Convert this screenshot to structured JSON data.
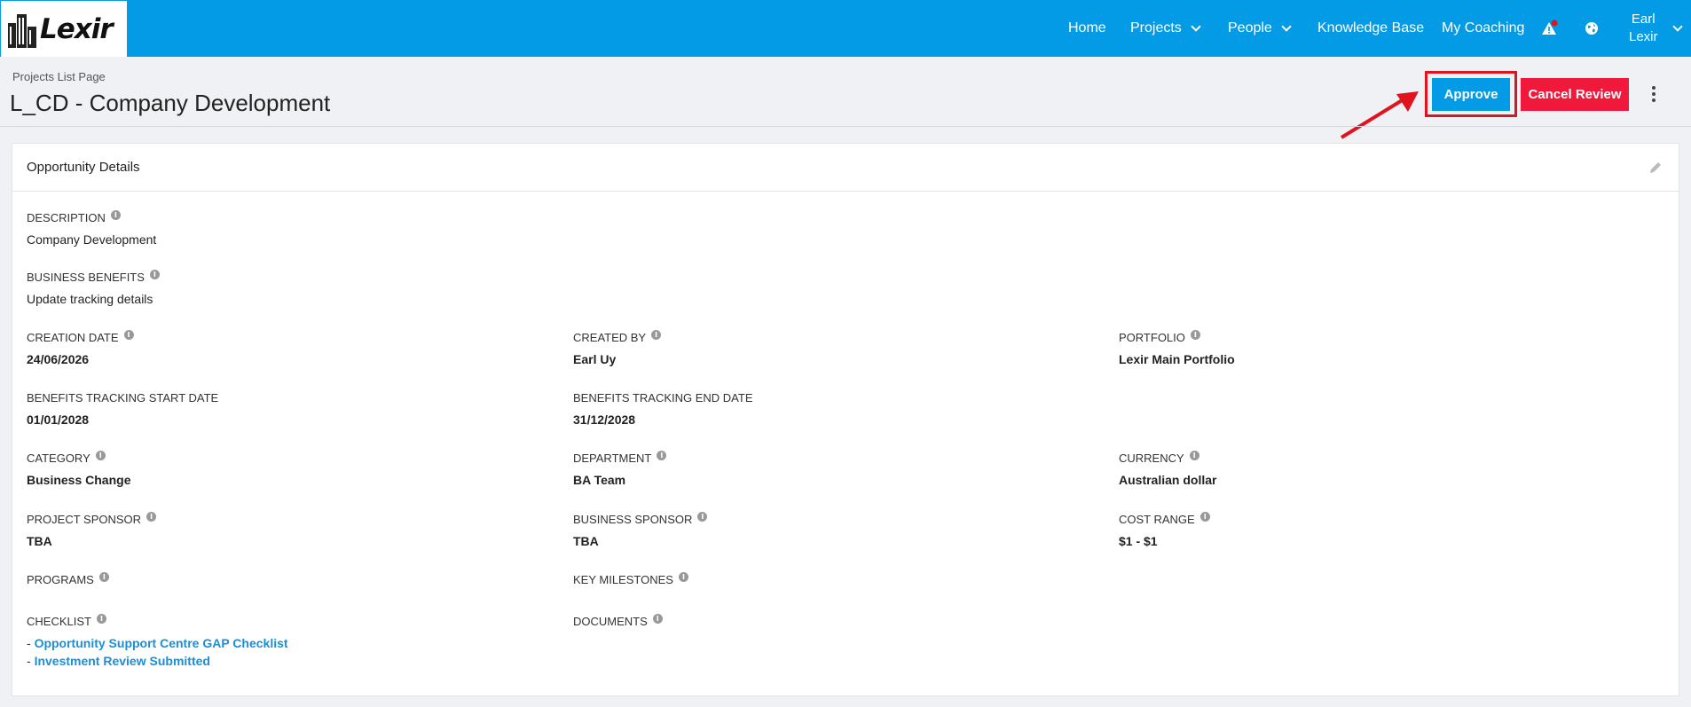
{
  "brand": {
    "logo_text": "Lexir"
  },
  "nav": {
    "home": "Home",
    "projects": "Projects",
    "people": "People",
    "knowledge_base": "Knowledge Base",
    "my_coaching": "My Coaching",
    "user_first": "Earl",
    "user_last": "Lexir"
  },
  "header": {
    "breadcrumb": "Projects List Page",
    "title": "L_CD - Company Development",
    "approve_label": "Approve",
    "cancel_review_label": "Cancel Review"
  },
  "colors": {
    "topbar": "#039be5",
    "approve": "#039be5",
    "cancel": "#f0193c",
    "highlight": "#e0141e",
    "link": "#1a8fd6"
  },
  "card": {
    "title": "Opportunity Details",
    "description_label": "DESCRIPTION",
    "description_value": "Company Development",
    "business_benefits_label": "BUSINESS BENEFITS",
    "business_benefits_value": "Update tracking details",
    "creation_date_label": "CREATION DATE",
    "creation_date_value": "24/06/2026",
    "created_by_label": "CREATED BY",
    "created_by_value": "Earl Uy",
    "portfolio_label": "PORTFOLIO",
    "portfolio_value": "Lexir Main Portfolio",
    "bt_start_label": "BENEFITS TRACKING START DATE",
    "bt_start_value": "01/01/2028",
    "bt_end_label": "BENEFITS TRACKING END DATE",
    "bt_end_value": "31/12/2028",
    "category_label": "CATEGORY",
    "category_value": "Business Change",
    "department_label": "DEPARTMENT",
    "department_value": "BA Team",
    "currency_label": "CURRENCY",
    "currency_value": "Australian dollar",
    "project_sponsor_label": "PROJECT SPONSOR",
    "project_sponsor_value": "TBA",
    "business_sponsor_label": "BUSINESS SPONSOR",
    "business_sponsor_value": "TBA",
    "cost_range_label": "COST RANGE",
    "cost_range_value": "$1 - $1",
    "programs_label": "PROGRAMS",
    "key_milestones_label": "KEY MILESTONES",
    "checklist_label": "CHECKLIST",
    "documents_label": "DOCUMENTS",
    "checklist_items": [
      "Opportunity Support Centre GAP Checklist",
      "Investment Review Submitted"
    ],
    "bullet": "-"
  }
}
